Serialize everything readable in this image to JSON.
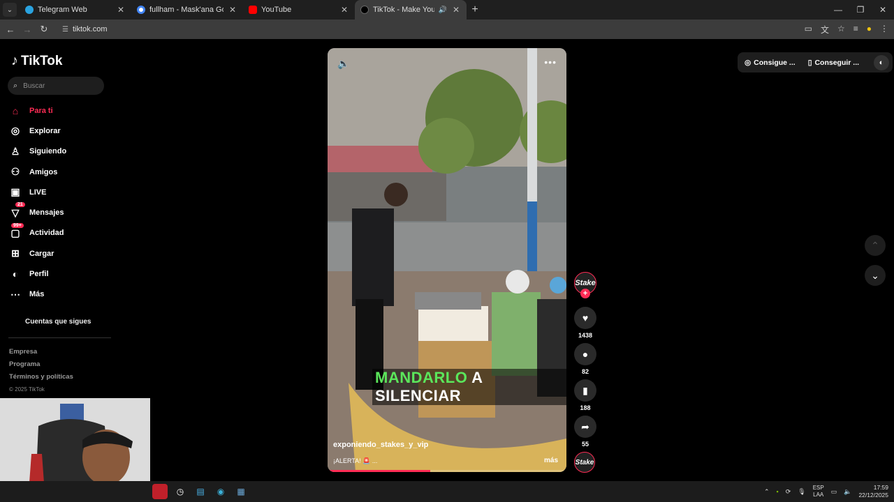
{
  "browser": {
    "tabs": [
      {
        "title": "Telegram Web",
        "favicon": "telegram-icon",
        "color": "#2aa3e0"
      },
      {
        "title": "fullham - Mask'ana Google",
        "favicon": "google-icon",
        "color": "#4285f4"
      },
      {
        "title": "YouTube",
        "favicon": "youtube-icon",
        "color": "#ff0000"
      },
      {
        "title": "TikTok - Make Your Day",
        "favicon": "tiktok-icon",
        "color": "#000000",
        "active": true
      }
    ],
    "url": "tiktok.com"
  },
  "sidebar": {
    "logo_text": "TikTok",
    "search_placeholder": "Buscar",
    "nav": [
      {
        "label": "Para ti",
        "icon": "home-icon",
        "active": true
      },
      {
        "label": "Explorar",
        "icon": "compass-icon"
      },
      {
        "label": "Siguiendo",
        "icon": "following-icon"
      },
      {
        "label": "Amigos",
        "icon": "friends-icon"
      },
      {
        "label": "LIVE",
        "icon": "live-icon"
      },
      {
        "label": "Mensajes",
        "icon": "messages-icon",
        "badge": "21"
      },
      {
        "label": "Actividad",
        "icon": "activity-icon",
        "badge": "99+"
      },
      {
        "label": "Cargar",
        "icon": "upload-icon"
      },
      {
        "label": "Perfil",
        "icon": "profile-icon"
      },
      {
        "label": "Más",
        "icon": "more-icon"
      }
    ],
    "following_accounts": "Cuentas que sigues",
    "footer": [
      "Empresa",
      "Programa",
      "Términos y políticas"
    ],
    "copyright": "© 2025 TikTok"
  },
  "video": {
    "caption_green": "MANDARLO",
    "caption_white": "A SILENCIAR",
    "username": "exponiendo_stakes_y_vip",
    "description": "¡ALERTA! 🚨 ...",
    "more": "más",
    "progress": 0.43
  },
  "actions": {
    "creator_avatar": "Stake",
    "likes": "1438",
    "comments": "82",
    "saves": "188",
    "shares": "55"
  },
  "top_right": {
    "btn1": "Consigue ...",
    "btn2": "Conseguir ..."
  },
  "taskbar": {
    "lang": "ESP",
    "lang2": "LAA",
    "time": "17:59",
    "date": "22/12/2025"
  },
  "colors": {
    "accent": "#fe2c55",
    "caption_green": "#5be65b"
  }
}
